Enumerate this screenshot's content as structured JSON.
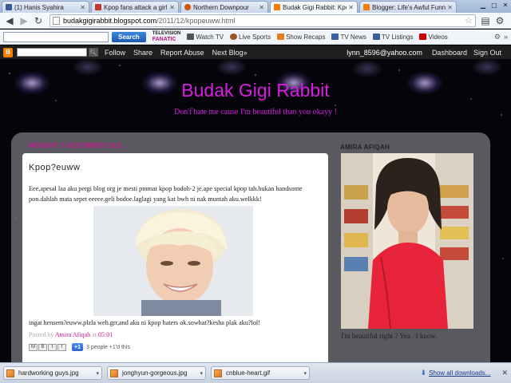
{
  "browser": {
    "tabs": [
      {
        "title": "(1) Hanis Syahira",
        "icon_color": "#3b5998",
        "active": false
      },
      {
        "title": "Kpop fans attack a girl and",
        "icon_color": "#c0392b",
        "active": false
      },
      {
        "title": "Northern Downpour",
        "icon_color": "#d35400",
        "active": false
      },
      {
        "title": "Budak Gigi Rabbit: Kpop?euww",
        "icon_color": "#f57d00",
        "active": true
      },
      {
        "title": "Blogger: Life's Awful Funny",
        "icon_color": "#f57d00",
        "active": false
      }
    ],
    "url_domain": "budakgigirabbit.blogspot.com",
    "url_path": "/2011/12/kpopeuww.html"
  },
  "toolbar": {
    "search_button": "Search",
    "logo_line1": "TELEVISION",
    "logo_line2": "FANATIC",
    "items": [
      {
        "label": "Watch TV",
        "icon": "tv-icon",
        "color": "#555"
      },
      {
        "label": "Live Sports",
        "icon": "football-icon",
        "color": "#a0522d"
      },
      {
        "label": "Show Recaps",
        "icon": "recaps-icon",
        "color": "#e67e22"
      },
      {
        "label": "TV News",
        "icon": "news-icon",
        "color": "#3a5fa0"
      },
      {
        "label": "TV Listings",
        "icon": "listings-icon",
        "color": "#3a5fa0"
      },
      {
        "label": "Videos",
        "icon": "youtube-icon",
        "color": "#cc0000"
      }
    ]
  },
  "blogger_nav": {
    "links": [
      "Follow",
      "Share",
      "Report Abuse",
      "Next Blog»"
    ],
    "email": "lynn_8596@yahoo.com",
    "dashboard": "Dashboard",
    "sign_out": "Sign Out"
  },
  "blog": {
    "title": "Budak Gigi Rabbit",
    "description": "Don't hate me cause I'm beautiful than you okayy !",
    "title_color": "#d91ee0"
  },
  "post": {
    "date": "MONDAY, 5 DECEMBER 2011",
    "title": "Kpop?euww",
    "body": "Eee,apesal laa aku pergi blog org je mesti pmmat kpop bodoh-2 je.ape special kpop tah.bukan handsome pon.dahlah mata sepet eeeee.geli bodoe.laglagi yang kat bwh ni nak muntah aku.welkkk!",
    "after_image": "ingat hensem?euww.plzla weh.grr,and aku ni kpop haters ok.sowhat?kesha plak aku?lol!",
    "posted_by_label": "Posted by",
    "author": "Amira Afiqah",
    "at_label": "at",
    "time": "05:01",
    "share_buttons": [
      "M",
      "B",
      "t",
      "f",
      "+1"
    ],
    "plusone_label": "+1",
    "plusone_count": "3 people +1'd this"
  },
  "sidebar": {
    "title": "AMIRA AFIQAH",
    "caption": "I'm beautiful right ? Yea , I know."
  },
  "downloads": {
    "items": [
      "hardworking guys.jpg",
      "jonghyun-gorgeous.jpg",
      "cnblue-heart.gif"
    ],
    "show_all": "Show all downloads..."
  }
}
